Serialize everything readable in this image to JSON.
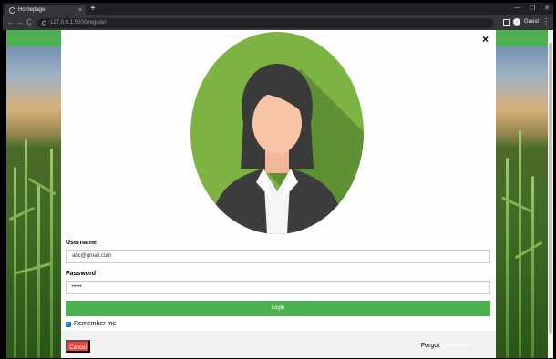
{
  "browser": {
    "tab_title": "Homepage",
    "tab_close": "×",
    "new_tab": "+",
    "url": "127.0.0.1:5000/register",
    "nav_back": "←",
    "nav_forward": "→",
    "nav_reload": "C",
    "profile_label": "Guest",
    "menu": "⋮",
    "win_min": "—",
    "win_max": "❐",
    "win_close": "✕"
  },
  "modal": {
    "close": "×",
    "username_label": "Username",
    "username_value": "abc@gmail.com",
    "password_label": "Password",
    "password_value": "•••••",
    "login_label": "Login",
    "remember_label": "Remember me",
    "remember_checked": true,
    "cancel_label": "Cancel",
    "forgot_label": "Forgot",
    "forgot_link": "password?"
  },
  "colors": {
    "accent_green": "#4caf50",
    "cancel_red": "#f44336",
    "avatar_bg": "#7cb342"
  },
  "icons": {
    "close": "close-icon",
    "checkbox": "check-icon",
    "lock": "lock-icon",
    "profile": "profile-icon"
  }
}
